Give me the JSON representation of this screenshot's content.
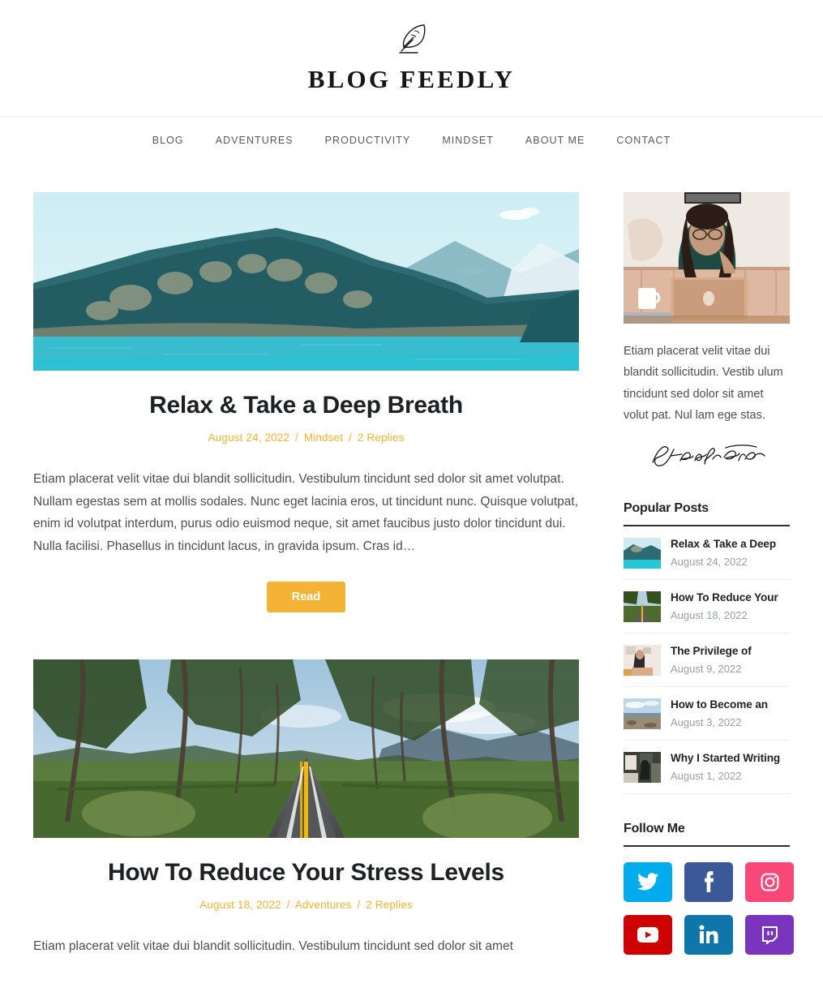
{
  "header": {
    "logo_icon": "feather-quill-icon",
    "site_title": "BLOG FEEDLY"
  },
  "nav": {
    "items": [
      {
        "label": "BLOG"
      },
      {
        "label": "ADVENTURES"
      },
      {
        "label": "PRODUCTIVITY"
      },
      {
        "label": "MINDSET"
      },
      {
        "label": "ABOUT ME"
      },
      {
        "label": "CONTACT"
      }
    ]
  },
  "posts": [
    {
      "image_alt": "mountain-lake-turquoise-water",
      "title": "Relax & Take a Deep Breath",
      "date": "August 24, 2022",
      "category": "Mindset",
      "replies": "2 Replies",
      "separator": "/",
      "excerpt": "Etiam placerat velit vitae dui blandit sollicitudin. Vestibulum tincidunt sed dolor sit amet volutpat. Nullam egestas sem at mollis sodales. Nunc eget lacinia eros, ut tincidunt nunc. Quisque volutpat, enim id volutpat interdum, purus odio euismod neque, sit amet faucibus justo dolor tincidunt dui. Nulla facilisi. Phasellus in tincidunt lacus, in gravida ipsum. Cras id…",
      "read_label": "Read"
    },
    {
      "image_alt": "tree-lined-road-countryside",
      "title": "How To Reduce Your Stress Levels",
      "date": "August 18, 2022",
      "category": "Adventures",
      "replies": "2 Replies",
      "separator": "/",
      "excerpt": "Etiam placerat velit vitae dui blandit sollicitudin. Vestibulum tincidunt sed dolor sit amet"
    }
  ],
  "sidebar": {
    "author": {
      "photo_alt": "woman-working-on-laptop",
      "bio": "Etiam placerat velit vitae dui blandit sollicitudin. Vestib ulum tincidunt sed dolor sit amet volut pat. Nul lam ege stas.",
      "signature_name": "Jenifer Carter"
    },
    "popular": {
      "title": "Popular Posts",
      "items": [
        {
          "title": "Relax & Take a Deep",
          "date": "August 24, 2022",
          "thumb": "lake"
        },
        {
          "title": "How To Reduce Your",
          "date": "August 18, 2022",
          "thumb": "road"
        },
        {
          "title": "The Privilege of",
          "date": "August 9, 2022",
          "thumb": "desk"
        },
        {
          "title": "How to Become an",
          "date": "August 3, 2022",
          "thumb": "beach"
        },
        {
          "title": "Why I Started Writing",
          "date": "August 1, 2022",
          "thumb": "room"
        }
      ]
    },
    "follow": {
      "title": "Follow Me",
      "items": [
        {
          "name": "twitter",
          "color": "#00ACEE"
        },
        {
          "name": "facebook",
          "color": "#3B5998"
        },
        {
          "name": "instagram",
          "color": "#F94877"
        },
        {
          "name": "youtube",
          "color": "#CE0000"
        },
        {
          "name": "linkedin",
          "color": "#0E76A8"
        },
        {
          "name": "twitch",
          "color": "#7A34BE"
        }
      ]
    }
  },
  "theme": {
    "accent": "#F5B335",
    "text_dark": "#1D2124",
    "text_body": "#4A4F54",
    "muted": "#9AA0A6"
  }
}
